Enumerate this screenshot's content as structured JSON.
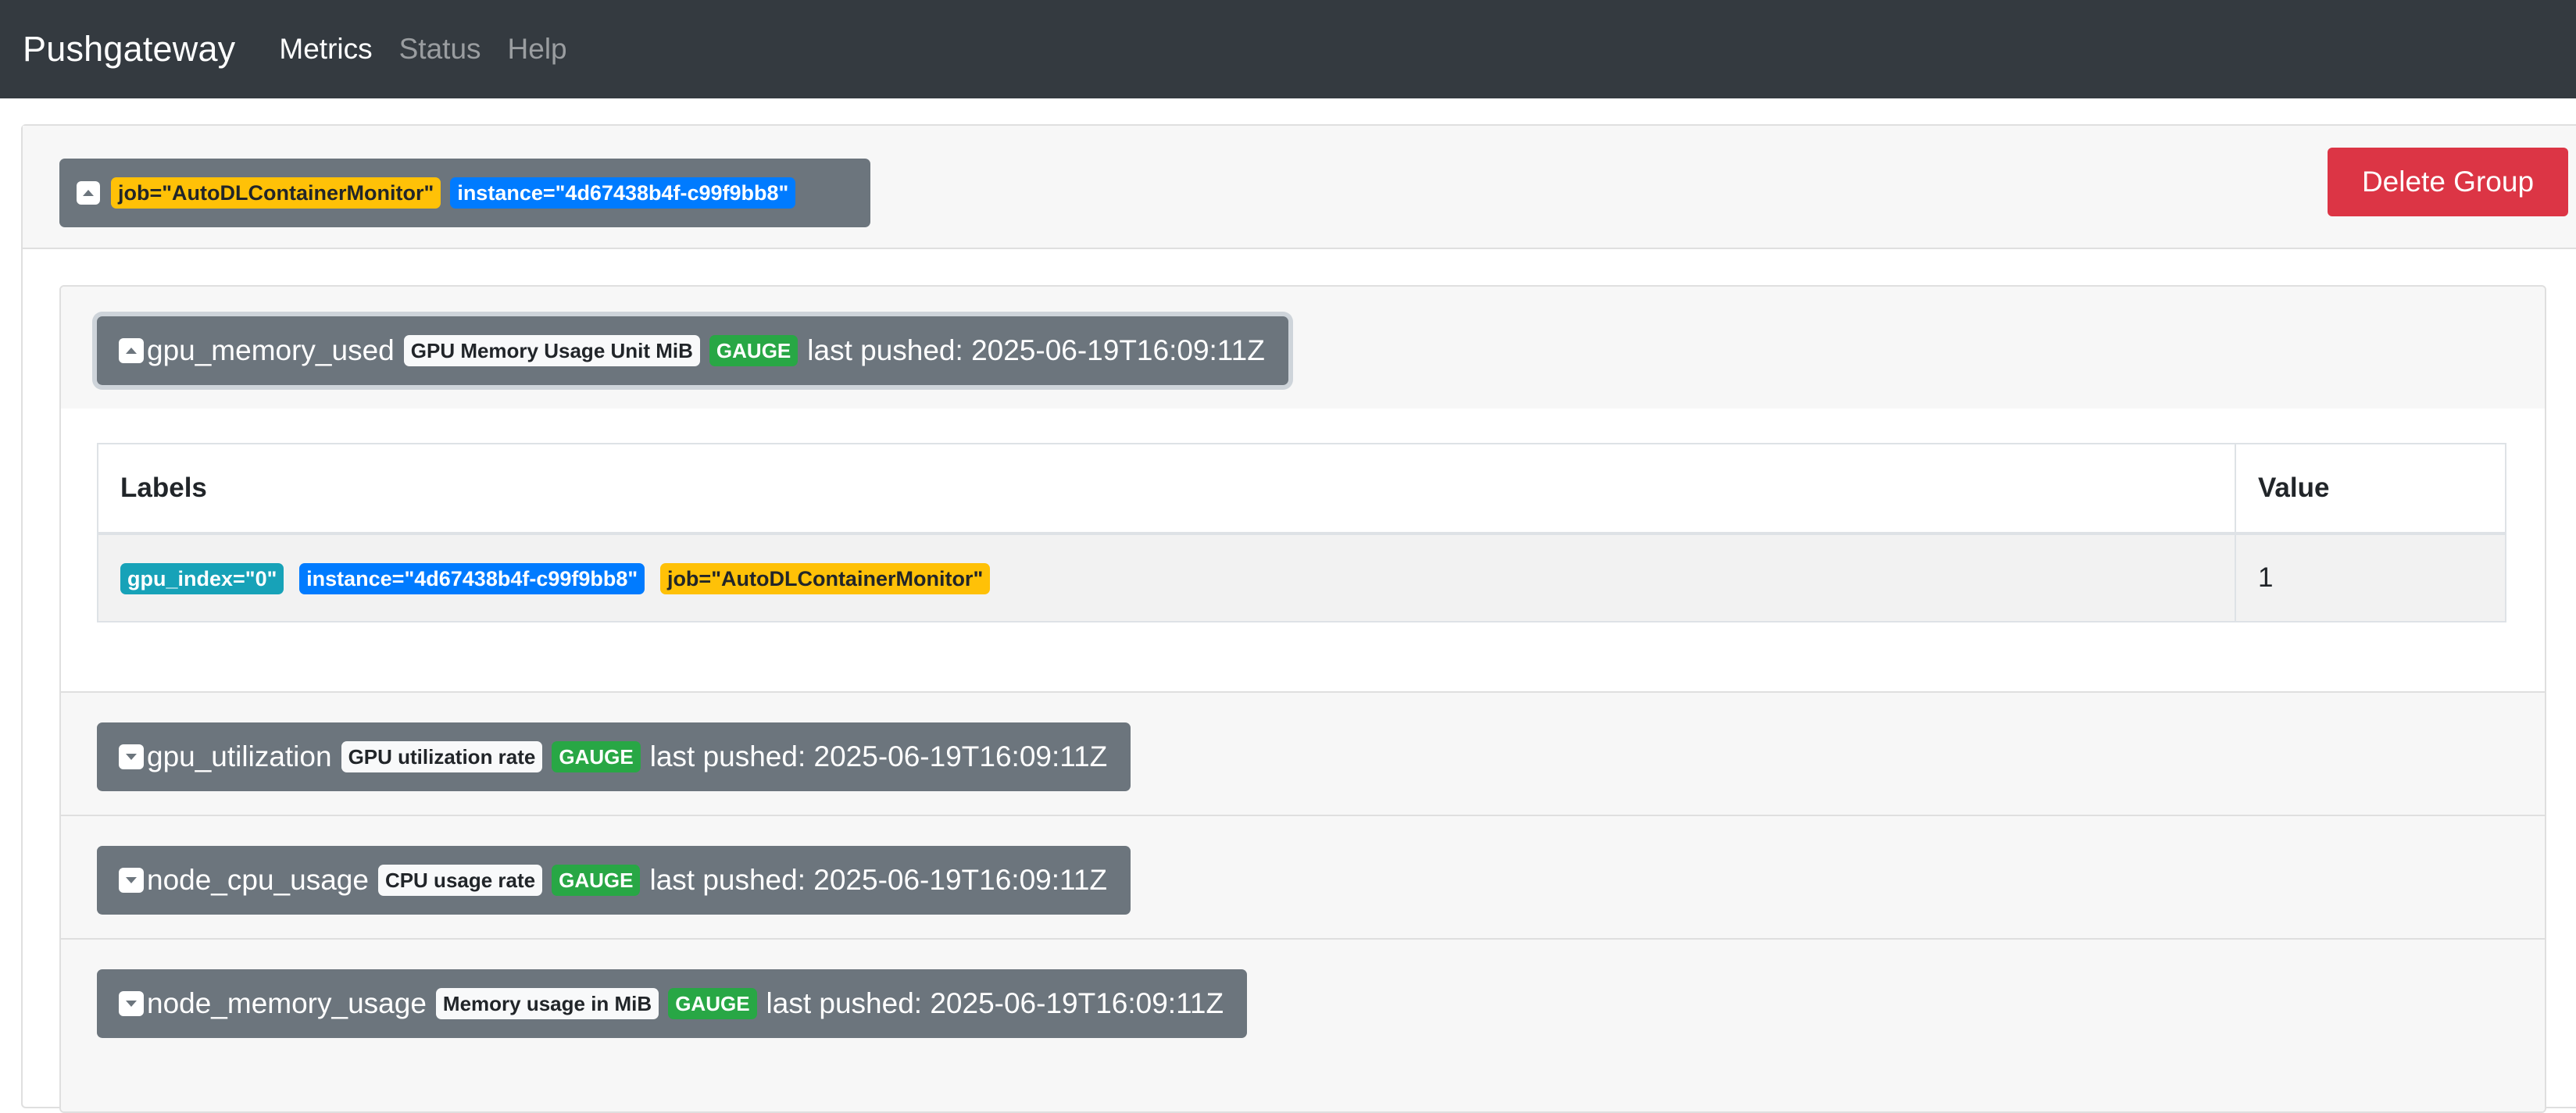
{
  "nav": {
    "brand": "Pushgateway",
    "links": [
      {
        "label": "Metrics",
        "active": true
      },
      {
        "label": "Status",
        "active": false
      },
      {
        "label": "Help",
        "active": false
      }
    ]
  },
  "group": {
    "labels": [
      {
        "text": "job=\"AutoDLContainerMonitor\"",
        "color": "warning"
      },
      {
        "text": "instance=\"4d67438b4f-c99f9bb8\"",
        "color": "primary"
      }
    ],
    "delete_label": "Delete Group"
  },
  "metrics": [
    {
      "name": "gpu_memory_used",
      "help": "GPU Memory Usage Unit MiB",
      "type": "GAUGE",
      "last_pushed": "last pushed: 2025-06-19T16:09:11Z",
      "expanded": true,
      "table": {
        "headers": [
          "Labels",
          "Value"
        ],
        "rows": [
          {
            "labels": [
              {
                "text": "gpu_index=\"0\"",
                "color": "info"
              },
              {
                "text": "instance=\"4d67438b4f-c99f9bb8\"",
                "color": "primary"
              },
              {
                "text": "job=\"AutoDLContainerMonitor\"",
                "color": "warning"
              }
            ],
            "value": "1"
          }
        ]
      }
    },
    {
      "name": "gpu_utilization",
      "help": "GPU utilization rate",
      "type": "GAUGE",
      "last_pushed": "last pushed: 2025-06-19T16:09:11Z",
      "expanded": false
    },
    {
      "name": "node_cpu_usage",
      "help": "CPU usage rate",
      "type": "GAUGE",
      "last_pushed": "last pushed: 2025-06-19T16:09:11Z",
      "expanded": false
    },
    {
      "name": "node_memory_usage",
      "help": "Memory usage in MiB",
      "type": "GAUGE",
      "last_pushed": "last pushed: 2025-06-19T16:09:11Z",
      "expanded": false
    }
  ],
  "icons": {
    "collapse": "caret-up-square-icon",
    "expand": "caret-down-square-icon"
  },
  "colors": {
    "navbar": "#343a40",
    "danger": "#dc3545",
    "secondary": "#6c757d",
    "warning": "#ffc107",
    "primary": "#007bff",
    "info": "#17a2b8",
    "success": "#28a745"
  }
}
